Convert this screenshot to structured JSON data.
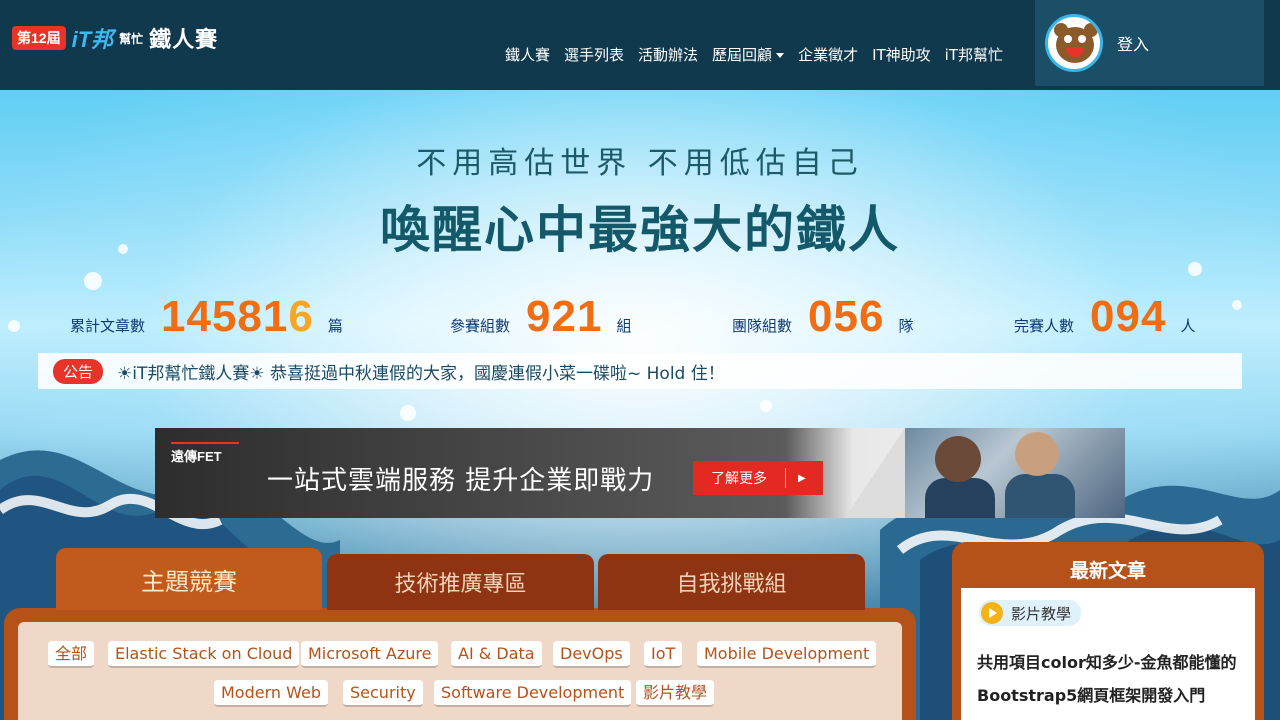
{
  "header": {
    "logo_badge": "第12屆",
    "logo_it": "iT邦",
    "logo_sub": "幫忙",
    "logo_main": "鐵人賽",
    "nav": [
      "鐵人賽",
      "選手列表",
      "活動辦法",
      "歷屆回顧",
      "企業徵才",
      "IT神助攻",
      "iT邦幫忙"
    ],
    "login_label": "登入"
  },
  "hero": {
    "slogan_top": "不用高估世界 不用低估自己",
    "slogan_main": "喚醒心中最強大的鐵人"
  },
  "stats": [
    {
      "label": "累計文章數",
      "value": "14581",
      "value_highlight": "6",
      "unit": "篇"
    },
    {
      "label": "參賽組數",
      "value": "921",
      "value_highlight": "",
      "unit": "組"
    },
    {
      "label": "團隊組數",
      "value": "056",
      "value_highlight": "",
      "unit": "隊"
    },
    {
      "label": "完賽人數",
      "value": "094",
      "value_highlight": "",
      "unit": "人"
    }
  ],
  "notice": {
    "badge": "公告",
    "text": "☀iT邦幫忙鐵人賽☀ 恭喜挺過中秋連假的大家，國慶連假小菜一碟啦~ Hold 住！"
  },
  "banner": {
    "brand": "遠傳FET",
    "headline": "一站式雲端服務  提升企業即戰力",
    "button": "了解更多",
    "button_arrow": "▶"
  },
  "tabs": [
    "主題競賽",
    "技術推廣專區",
    "自我挑戰組"
  ],
  "tags": [
    "全部",
    "Elastic Stack on Cloud",
    "Microsoft Azure",
    "AI & Data",
    "DevOps",
    "IoT",
    "Mobile Development",
    "Modern Web",
    "Security",
    "Software Development",
    "影片教學"
  ],
  "latest": {
    "title": "最新文章",
    "tag": "影片教學",
    "article_title": "共用項目color知多少-金魚都能懂的Bootstrap5網頁框架開發入門"
  },
  "colors": {
    "header_bg": "#11394e",
    "accent_orange": "#f06d13",
    "tab_brown": "#b5521a",
    "notice_red": "#e8332b"
  }
}
